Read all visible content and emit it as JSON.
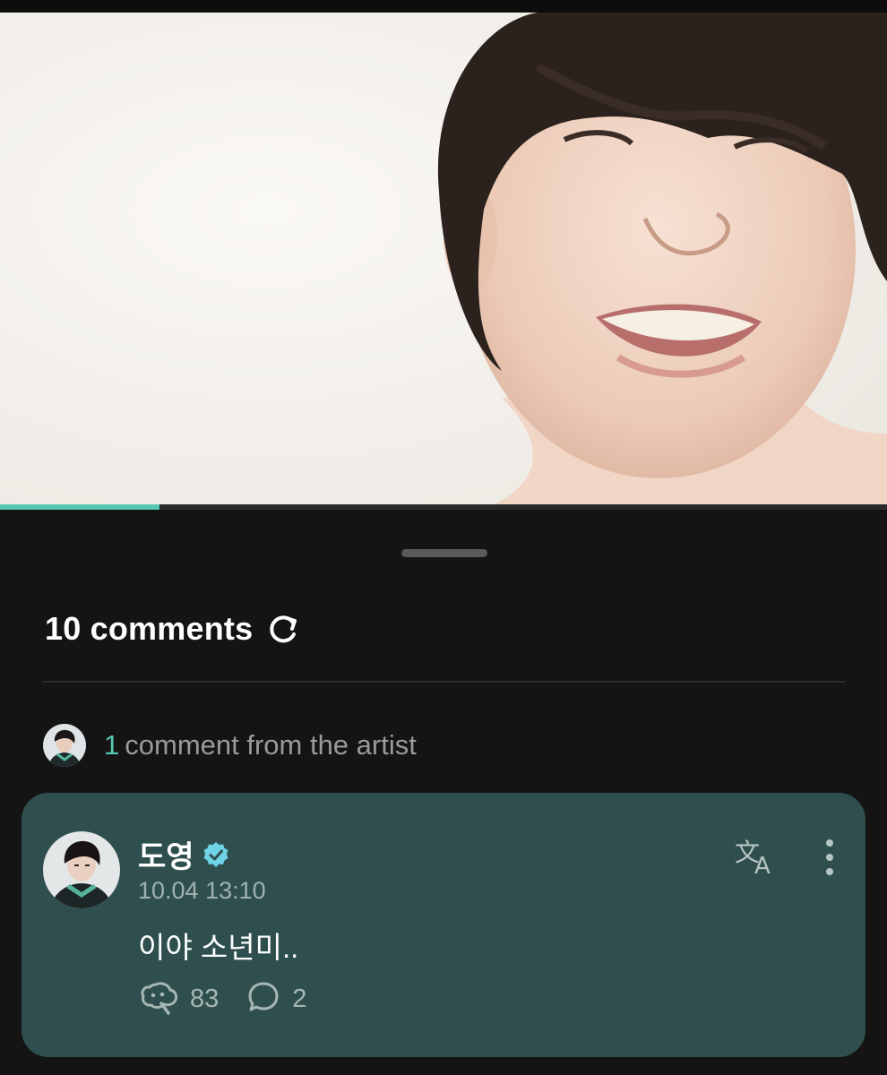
{
  "video": {
    "progress_percent": 18
  },
  "comments": {
    "header_label": "10 comments"
  },
  "artist_summary": {
    "count": "1",
    "label": "comment from the artist"
  },
  "comment": {
    "author": "도영",
    "timestamp": "10.04 13:10",
    "text": "이야 소년미..",
    "likes": "83",
    "replies": "2"
  },
  "icons": {
    "refresh": "refresh-icon",
    "verified": "verified-badge-icon",
    "translate": "translate-icon",
    "more": "more-vertical-icon",
    "like": "like-icon",
    "reply": "reply-icon"
  },
  "colors": {
    "background": "#121212",
    "accent": "#58c9b0",
    "card": "#2f4f4f",
    "muted_text": "#9a9a9a"
  }
}
